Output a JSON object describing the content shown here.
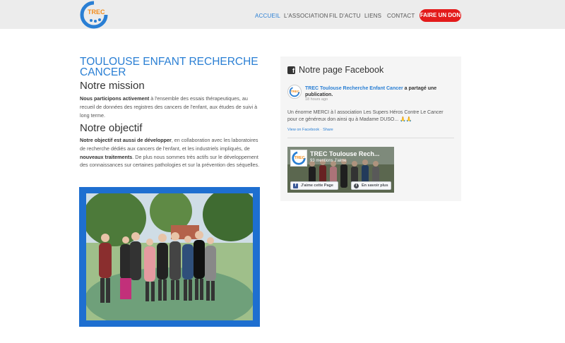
{
  "nav": {
    "items": [
      {
        "label": "ACCUEIL"
      },
      {
        "label": "L'ASSOCIATION"
      },
      {
        "label": "FIL D'ACTU"
      },
      {
        "label": "LIENS"
      },
      {
        "label": "CONTACT"
      }
    ],
    "cta_label": "FAIRE UN DON"
  },
  "logo": {
    "text": "TREC"
  },
  "main": {
    "title": "TOULOUSE ENFANT RECHERCHE CANCER",
    "mission_heading": "Notre mission",
    "mission_bold": "Nous participons activement",
    "mission_text": " à l'ensemble des essais thérapeutiques, au recueil de données des registres des cancers de l'enfant, aux études de suivi à long terme.",
    "objectif_heading": "Notre objectif",
    "objectif_bold1": "Notre objectif est aussi de développer",
    "objectif_text1": ", en collaboration avec les laboratoires de recherche dédiés aux cancers de l'enfant, et les industriels impliqués, de ",
    "objectif_bold2": "nouveaux traitements",
    "objectif_text2": ". De plus nous sommes très actifs sur le développement des connaissances sur certaines pathologies et sur la prévention des séquelles."
  },
  "facebook": {
    "heading": "Notre page Facebook",
    "post_page": "TREC Toulouse Recherche Enfant Cancer",
    "post_action": " a partagé une publication.",
    "post_time": "18 hours ago",
    "post_text": "Un énorme MERCI à l association Les Supers Héros Contre Le Cancer pour ce généreux don ainsi qu à Madame DUSO... 🙏🙏",
    "link_view": "View on Facebook",
    "link_sep": "·",
    "link_share": "Share",
    "card_name": "TREC Toulouse Rech...",
    "card_likes": "93 mentions J'aime",
    "btn_like": "J'aime cette Page",
    "btn_more": "En savoir plus"
  },
  "colors": {
    "accent": "#2a7fd4",
    "cta": "#e31b1b",
    "photo_frame": "#1e6fd0",
    "header_bg": "#ececec"
  }
}
